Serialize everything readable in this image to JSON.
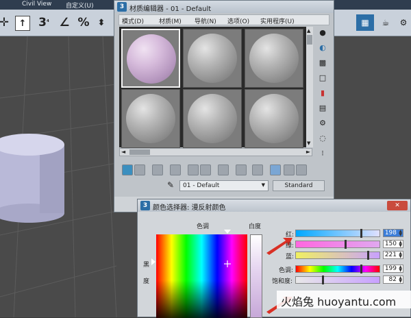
{
  "menubar": {
    "items": [
      "Civil View",
      "自定义(U)"
    ]
  },
  "toolbar": {
    "icons": [
      "plus-icon",
      "select-icon",
      "snap-3d-icon",
      "angle-snap-icon",
      "percent-snap-icon",
      "spinner-snap-icon"
    ],
    "snap_label": "3",
    "percent_label": "%"
  },
  "material_editor": {
    "app_icon": "3",
    "title": "材质编辑器 - 01 - Default",
    "menu": [
      "模式(D)",
      "材质(M)",
      "导航(N)",
      "选项(O)",
      "实用程序(U)"
    ],
    "material_name": "01 - Default",
    "material_type": "Standard",
    "slot_count": 6,
    "active_slot": 0
  },
  "color_selector": {
    "app_icon": "3",
    "title": "颜色选择器: 漫反射颜色",
    "hue_label": "色调",
    "whiteness_label": "白度",
    "blackness_label": "黑",
    "degree_label": "度",
    "channels": [
      {
        "label": "红:",
        "value": "198",
        "fill": 0.78,
        "selected": true
      },
      {
        "label": "绿:",
        "value": "150",
        "fill": 0.59,
        "selected": false
      },
      {
        "label": "蓝:",
        "value": "221",
        "fill": 0.87,
        "selected": false
      },
      {
        "label": "色调:",
        "value": "199",
        "fill": 0.78,
        "selected": false
      },
      {
        "label": "饱和度:",
        "value": "82",
        "fill": 0.32,
        "selected": false
      }
    ],
    "colors": {
      "red": "#ff3b30",
      "sample": "#c14a4a"
    }
  },
  "watermark": {
    "text": "火焰兔 huoyantu.com"
  }
}
